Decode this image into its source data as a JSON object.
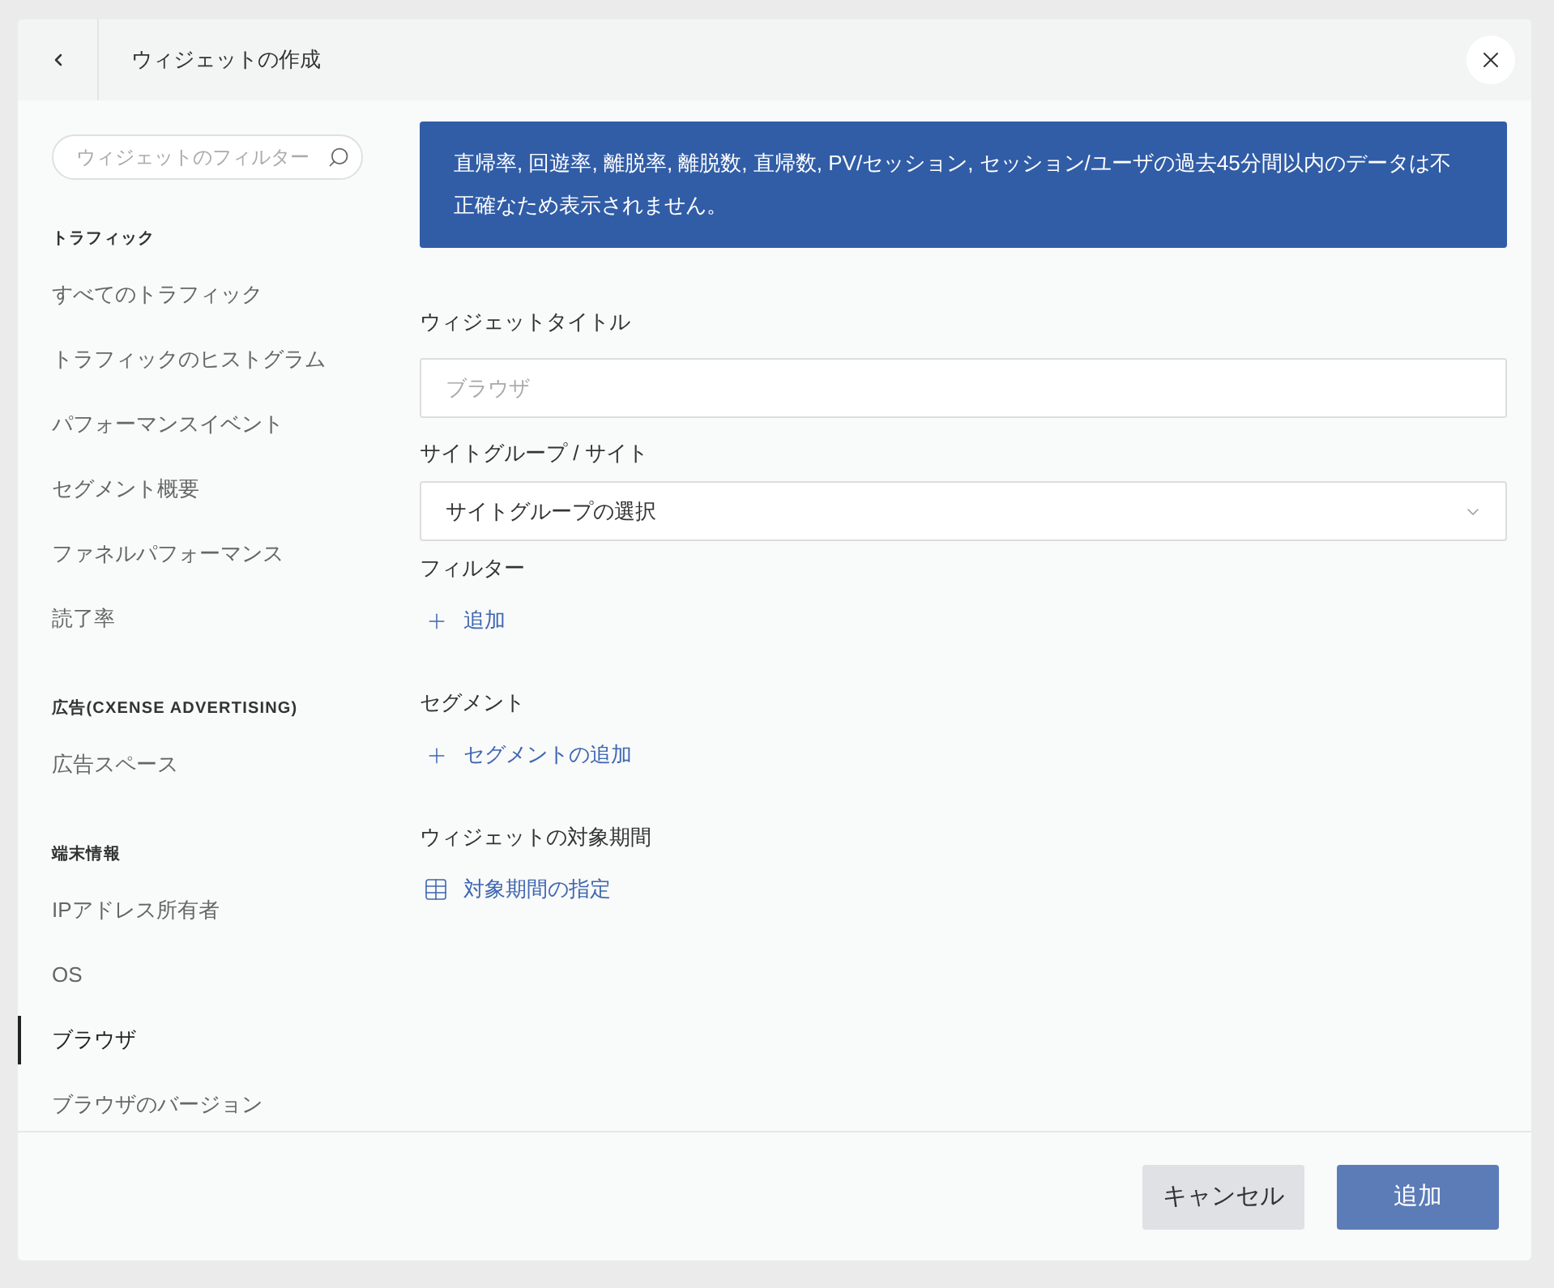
{
  "dialog": {
    "title": "ウィジェットの作成"
  },
  "sidebar": {
    "search": {
      "placeholder": "ウィジェットのフィルター"
    },
    "sections": [
      {
        "heading": "トラフィック",
        "items": [
          {
            "label": "すべてのトラフィック",
            "selected": false
          },
          {
            "label": "トラフィックのヒストグラム",
            "selected": false
          },
          {
            "label": "パフォーマンスイベント",
            "selected": false
          },
          {
            "label": "セグメント概要",
            "selected": false
          },
          {
            "label": "ファネルパフォーマンス",
            "selected": false
          },
          {
            "label": "読了率",
            "selected": false
          }
        ]
      },
      {
        "heading": "広告(CXENSE ADVERTISING)",
        "items": [
          {
            "label": "広告スペース",
            "selected": false
          }
        ]
      },
      {
        "heading": "端末情報",
        "items": [
          {
            "label": "IPアドレス所有者",
            "selected": false
          },
          {
            "label": "OS",
            "selected": false
          },
          {
            "label": "ブラウザ",
            "selected": true
          },
          {
            "label": "ブラウザのバージョン",
            "selected": false
          }
        ]
      }
    ]
  },
  "notice": "直帰率, 回遊率, 離脱率, 離脱数, 直帰数, PV/セッション, セッション/ユーザの過去45分間以内のデータは不正確なため表示されません。",
  "form": {
    "fields": [
      {
        "kind": "text",
        "label": "ウィジェットタイトル",
        "placeholder": "ブラウザ"
      },
      {
        "kind": "select",
        "label": "サイトグループ / サイト",
        "value": "サイトグループの選択"
      },
      {
        "kind": "add",
        "label": "フィルター",
        "action": "追加"
      },
      {
        "kind": "add",
        "label": "セグメント",
        "action": "セグメントの追加"
      },
      {
        "kind": "period",
        "label": "ウィジェットの対象期間",
        "action": "対象期間の指定"
      }
    ]
  },
  "buttons": [
    {
      "kind": "secondary",
      "label": "キャンセル",
      "disabled": false
    },
    {
      "kind": "primary",
      "label": "追加",
      "disabled": true
    }
  ]
}
